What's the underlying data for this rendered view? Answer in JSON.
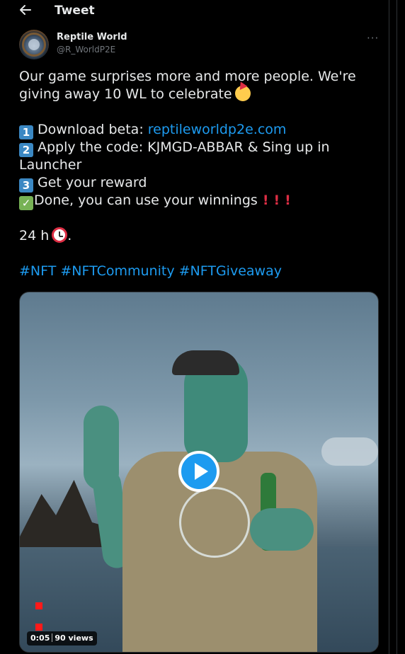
{
  "header": {
    "title": "Tweet",
    "back_icon": "arrow-left-icon"
  },
  "author": {
    "name": "Reptile World",
    "handle": "@R_WorldP2E",
    "more_label": "···"
  },
  "tweet": {
    "line1": "Our game surprises more and more people. We're",
    "line2": "giving away 10 WL to celebrate",
    "step1_num": "1",
    "step1_text": "Download beta: ",
    "step1_link": "reptileworldp2e.com",
    "step2_num": "2",
    "step2_text": "Apply the code: KJMGD-ABBAR & Sing up in",
    "step2_cont": "Launcher",
    "step3_num": "3",
    "step3_text": "Get your reward",
    "done_text": "Done, you can use your winnings",
    "deadline": "24 h",
    "hashtags": [
      "#NFT",
      "#NFTCommunity",
      "#NFTGiveaway"
    ]
  },
  "video": {
    "time": "0:05",
    "views": "90 views"
  },
  "colors": {
    "background": "#000000",
    "text": "#e7e9ea",
    "secondary": "#71767b",
    "link": "#1d9bf0"
  }
}
